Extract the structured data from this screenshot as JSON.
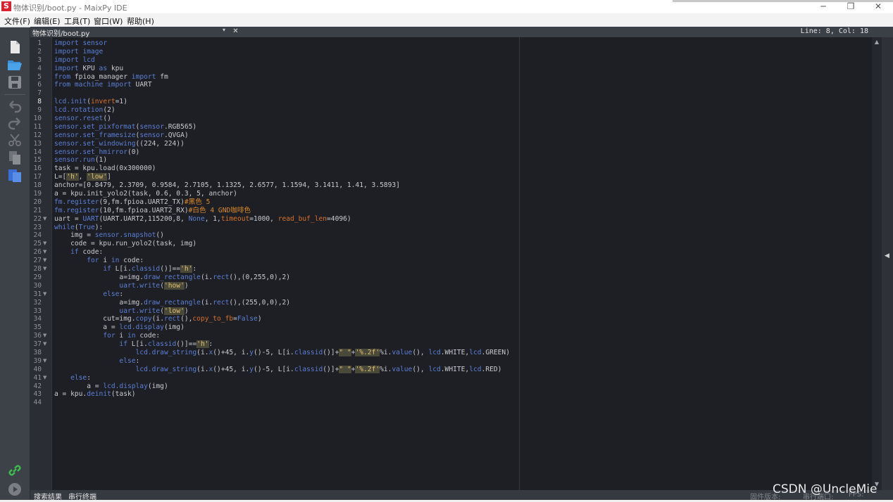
{
  "window": {
    "title": "物体识别/boot.py - MaixPy IDE",
    "app_icon": "S",
    "minimize_glyph": "─",
    "maximize_glyph": "❐",
    "close_glyph": "✕"
  },
  "menu": [
    "文件(F)",
    "编辑(E)",
    "工具(T)",
    "窗口(W)",
    "帮助(H)"
  ],
  "sidebar": {
    "icons": [
      "new-file-icon",
      "open-folder-icon",
      "save-icon",
      "undo-icon",
      "redo-icon",
      "cut-icon",
      "copy-icon",
      "paste-icon",
      "connect-icon",
      "run-icon"
    ]
  },
  "editor": {
    "tab_title": "物体识别/boot.py",
    "tab_dropdown": "▾",
    "tab_close": "✕",
    "cursor_position": "Line: 8, Col: 18",
    "current_line": 8,
    "fold_markers": [
      22,
      25,
      26,
      27,
      28,
      31,
      36,
      37,
      39,
      41
    ],
    "lines": [
      [
        {
          "t": "kw",
          "s": "import "
        },
        {
          "t": "mod",
          "s": "sensor"
        }
      ],
      [
        {
          "t": "kw",
          "s": "import "
        },
        {
          "t": "mod",
          "s": "image"
        }
      ],
      [
        {
          "t": "kw",
          "s": "import "
        },
        {
          "t": "mod",
          "s": "lcd"
        }
      ],
      [
        {
          "t": "kw",
          "s": "import "
        },
        {
          "t": "plain",
          "s": "KPU "
        },
        {
          "t": "kw",
          "s": "as "
        },
        {
          "t": "plain",
          "s": "kpu"
        }
      ],
      [
        {
          "t": "kw",
          "s": "from "
        },
        {
          "t": "plain",
          "s": "fpioa_manager "
        },
        {
          "t": "kw",
          "s": "import "
        },
        {
          "t": "plain",
          "s": "fm"
        }
      ],
      [
        {
          "t": "kw",
          "s": "from "
        },
        {
          "t": "mod",
          "s": "machine "
        },
        {
          "t": "kw",
          "s": "import "
        },
        {
          "t": "plain",
          "s": "UART"
        }
      ],
      [],
      [
        {
          "t": "fn",
          "s": "lcd.init"
        },
        {
          "t": "plain",
          "s": "("
        },
        {
          "t": "param",
          "s": "invert"
        },
        {
          "t": "plain",
          "s": "=1)"
        }
      ],
      [
        {
          "t": "fn",
          "s": "lcd.rotation"
        },
        {
          "t": "plain",
          "s": "(2)"
        }
      ],
      [
        {
          "t": "fn",
          "s": "sensor.reset"
        },
        {
          "t": "plain",
          "s": "()"
        }
      ],
      [
        {
          "t": "fn",
          "s": "sensor.set_pixformat"
        },
        {
          "t": "plain",
          "s": "("
        },
        {
          "t": "fn",
          "s": "sensor"
        },
        {
          "t": "plain",
          "s": ".RGB565)"
        }
      ],
      [
        {
          "t": "fn",
          "s": "sensor.set_framesize"
        },
        {
          "t": "plain",
          "s": "("
        },
        {
          "t": "fn",
          "s": "sensor"
        },
        {
          "t": "plain",
          "s": ".QVGA)"
        }
      ],
      [
        {
          "t": "fn",
          "s": "sensor.set_windowing"
        },
        {
          "t": "plain",
          "s": "((224, 224))"
        }
      ],
      [
        {
          "t": "fn",
          "s": "sensor.set_hmirror"
        },
        {
          "t": "plain",
          "s": "(0)"
        }
      ],
      [
        {
          "t": "fn",
          "s": "sensor.run"
        },
        {
          "t": "plain",
          "s": "(1)"
        }
      ],
      [
        {
          "t": "plain",
          "s": "task = kpu.load(0x300000)"
        }
      ],
      [
        {
          "t": "plain",
          "s": "L=["
        },
        {
          "t": "str",
          "s": "'h'"
        },
        {
          "t": "plain",
          "s": ", "
        },
        {
          "t": "str",
          "s": "'low'"
        },
        {
          "t": "plain",
          "s": "]"
        }
      ],
      [
        {
          "t": "plain",
          "s": "anchor=[0.8479, 2.3709, 0.9584, 2.7105, 1.1325, 2.6577, 1.1594, 3.1411, 1.41, 3.5893]"
        }
      ],
      [
        {
          "t": "plain",
          "s": "a = kpu.init_yolo2(task, 0.6, 0.3, 5, anchor)"
        }
      ],
      [
        {
          "t": "fn",
          "s": "fm.register"
        },
        {
          "t": "plain",
          "s": "(9,fm.fpioa.UART2_TX)"
        },
        {
          "t": "cmt",
          "s": "#黑色 5"
        }
      ],
      [
        {
          "t": "fn",
          "s": "fm.register"
        },
        {
          "t": "plain",
          "s": "(10,fm.fpioa.UART2_RX)"
        },
        {
          "t": "cmt",
          "s": "#白色 4 GND咖啡色"
        }
      ],
      [
        {
          "t": "plain",
          "s": "uart = "
        },
        {
          "t": "fn",
          "s": "UART"
        },
        {
          "t": "plain",
          "s": "(UART.UART2,115200,8, "
        },
        {
          "t": "kw",
          "s": "None"
        },
        {
          "t": "plain",
          "s": ", 1,"
        },
        {
          "t": "param",
          "s": "timeout"
        },
        {
          "t": "plain",
          "s": "=1000, "
        },
        {
          "t": "param",
          "s": "read_buf_len"
        },
        {
          "t": "plain",
          "s": "=4096)"
        }
      ],
      [
        {
          "t": "kw",
          "s": "while"
        },
        {
          "t": "plain",
          "s": "("
        },
        {
          "t": "kw",
          "s": "True"
        },
        {
          "t": "plain",
          "s": "):"
        }
      ],
      [
        {
          "t": "plain",
          "s": "    img = "
        },
        {
          "t": "fn",
          "s": "sensor.snapshot"
        },
        {
          "t": "plain",
          "s": "()"
        }
      ],
      [
        {
          "t": "plain",
          "s": "    code = kpu.run_yolo2(task, img)"
        }
      ],
      [
        {
          "t": "plain",
          "s": "    "
        },
        {
          "t": "kw",
          "s": "if "
        },
        {
          "t": "plain",
          "s": "code:"
        }
      ],
      [
        {
          "t": "plain",
          "s": "        "
        },
        {
          "t": "kw",
          "s": "for "
        },
        {
          "t": "plain",
          "s": "i "
        },
        {
          "t": "kw",
          "s": "in "
        },
        {
          "t": "plain",
          "s": "code:"
        }
      ],
      [
        {
          "t": "plain",
          "s": "            "
        },
        {
          "t": "kw",
          "s": "if "
        },
        {
          "t": "plain",
          "s": "L[i."
        },
        {
          "t": "fn",
          "s": "classid"
        },
        {
          "t": "plain",
          "s": "()]=="
        },
        {
          "t": "str",
          "s": "'h'"
        },
        {
          "t": "plain",
          "s": ":"
        }
      ],
      [
        {
          "t": "plain",
          "s": "                a=img."
        },
        {
          "t": "fn",
          "s": "draw_rectangle"
        },
        {
          "t": "plain",
          "s": "(i."
        },
        {
          "t": "fn",
          "s": "rect"
        },
        {
          "t": "plain",
          "s": "(),(0,255,0),2)"
        }
      ],
      [
        {
          "t": "plain",
          "s": "                "
        },
        {
          "t": "fn",
          "s": "uart.write"
        },
        {
          "t": "plain",
          "s": "("
        },
        {
          "t": "str",
          "s": "'how'"
        },
        {
          "t": "plain",
          "s": ")"
        }
      ],
      [
        {
          "t": "plain",
          "s": "            "
        },
        {
          "t": "kw",
          "s": "else"
        },
        {
          "t": "plain",
          "s": ":"
        }
      ],
      [
        {
          "t": "plain",
          "s": "                a=img."
        },
        {
          "t": "fn",
          "s": "draw_rectangle"
        },
        {
          "t": "plain",
          "s": "(i."
        },
        {
          "t": "fn",
          "s": "rect"
        },
        {
          "t": "plain",
          "s": "(),(255,0,0),2)"
        }
      ],
      [
        {
          "t": "plain",
          "s": "                "
        },
        {
          "t": "fn",
          "s": "uart.write"
        },
        {
          "t": "plain",
          "s": "("
        },
        {
          "t": "str",
          "s": "'low'"
        },
        {
          "t": "plain",
          "s": ")"
        }
      ],
      [
        {
          "t": "plain",
          "s": "            cut=img."
        },
        {
          "t": "fn",
          "s": "copy"
        },
        {
          "t": "plain",
          "s": "(i."
        },
        {
          "t": "fn",
          "s": "rect"
        },
        {
          "t": "plain",
          "s": "(),"
        },
        {
          "t": "param",
          "s": "copy_to_fb"
        },
        {
          "t": "plain",
          "s": "="
        },
        {
          "t": "kw",
          "s": "False"
        },
        {
          "t": "plain",
          "s": ")"
        }
      ],
      [
        {
          "t": "plain",
          "s": "            a = "
        },
        {
          "t": "fn",
          "s": "lcd.display"
        },
        {
          "t": "plain",
          "s": "(img)"
        }
      ],
      [
        {
          "t": "plain",
          "s": "            "
        },
        {
          "t": "kw",
          "s": "for "
        },
        {
          "t": "plain",
          "s": "i "
        },
        {
          "t": "kw",
          "s": "in "
        },
        {
          "t": "plain",
          "s": "code:"
        }
      ],
      [
        {
          "t": "plain",
          "s": "                "
        },
        {
          "t": "kw",
          "s": "if "
        },
        {
          "t": "plain",
          "s": "L[i."
        },
        {
          "t": "fn",
          "s": "classid"
        },
        {
          "t": "plain",
          "s": "()]=="
        },
        {
          "t": "str",
          "s": "'h'"
        },
        {
          "t": "plain",
          "s": ":"
        }
      ],
      [
        {
          "t": "plain",
          "s": "                    "
        },
        {
          "t": "fn",
          "s": "lcd.draw_string"
        },
        {
          "t": "plain",
          "s": "(i."
        },
        {
          "t": "fn",
          "s": "x"
        },
        {
          "t": "plain",
          "s": "()+45, i."
        },
        {
          "t": "fn",
          "s": "y"
        },
        {
          "t": "plain",
          "s": "()-5, L[i."
        },
        {
          "t": "fn",
          "s": "classid"
        },
        {
          "t": "plain",
          "s": "()]+"
        },
        {
          "t": "str",
          "s": "\" \""
        },
        {
          "t": "plain",
          "s": "+"
        },
        {
          "t": "str",
          "s": "'%.2f'"
        },
        {
          "t": "plain",
          "s": "%i."
        },
        {
          "t": "fn",
          "s": "value"
        },
        {
          "t": "plain",
          "s": "(), "
        },
        {
          "t": "fn",
          "s": "lcd"
        },
        {
          "t": "plain",
          "s": ".WHITE,"
        },
        {
          "t": "fn",
          "s": "lcd"
        },
        {
          "t": "plain",
          "s": ".GREEN)"
        }
      ],
      [
        {
          "t": "plain",
          "s": "                "
        },
        {
          "t": "kw",
          "s": "else"
        },
        {
          "t": "plain",
          "s": ":"
        }
      ],
      [
        {
          "t": "plain",
          "s": "                    "
        },
        {
          "t": "fn",
          "s": "lcd.draw_string"
        },
        {
          "t": "plain",
          "s": "(i."
        },
        {
          "t": "fn",
          "s": "x"
        },
        {
          "t": "plain",
          "s": "()+45, i."
        },
        {
          "t": "fn",
          "s": "y"
        },
        {
          "t": "plain",
          "s": "()-5, L[i."
        },
        {
          "t": "fn",
          "s": "classid"
        },
        {
          "t": "plain",
          "s": "()]+"
        },
        {
          "t": "str",
          "s": "\" \""
        },
        {
          "t": "plain",
          "s": "+"
        },
        {
          "t": "str",
          "s": "'%.2f'"
        },
        {
          "t": "plain",
          "s": "%i."
        },
        {
          "t": "fn",
          "s": "value"
        },
        {
          "t": "plain",
          "s": "(), "
        },
        {
          "t": "fn",
          "s": "lcd"
        },
        {
          "t": "plain",
          "s": ".WHITE,"
        },
        {
          "t": "fn",
          "s": "lcd"
        },
        {
          "t": "plain",
          "s": ".RED)"
        }
      ],
      [
        {
          "t": "plain",
          "s": "    "
        },
        {
          "t": "kw",
          "s": "else"
        },
        {
          "t": "plain",
          "s": ":"
        }
      ],
      [
        {
          "t": "plain",
          "s": "        a = "
        },
        {
          "t": "fn",
          "s": "lcd.display"
        },
        {
          "t": "plain",
          "s": "(img)"
        }
      ],
      [
        {
          "t": "plain",
          "s": "a = kpu."
        },
        {
          "t": "fn",
          "s": "deinit"
        },
        {
          "t": "plain",
          "s": "(task)"
        }
      ],
      []
    ]
  },
  "bottom": {
    "tabs": [
      "搜索结果",
      "串行终端"
    ],
    "faded_status": [
      "固件版本:",
      "串行端口:",
      "FPS:"
    ]
  },
  "watermark": "CSDN @UncleMie",
  "colors": {
    "editor_bg": "#1e1f24",
    "keyword": "#5b7fd6",
    "string": "#e1c16e",
    "param": "#d6712c",
    "comment": "#d98a2a",
    "connect_icon": "#3fb950",
    "open_icon": "#4aa3e8"
  }
}
